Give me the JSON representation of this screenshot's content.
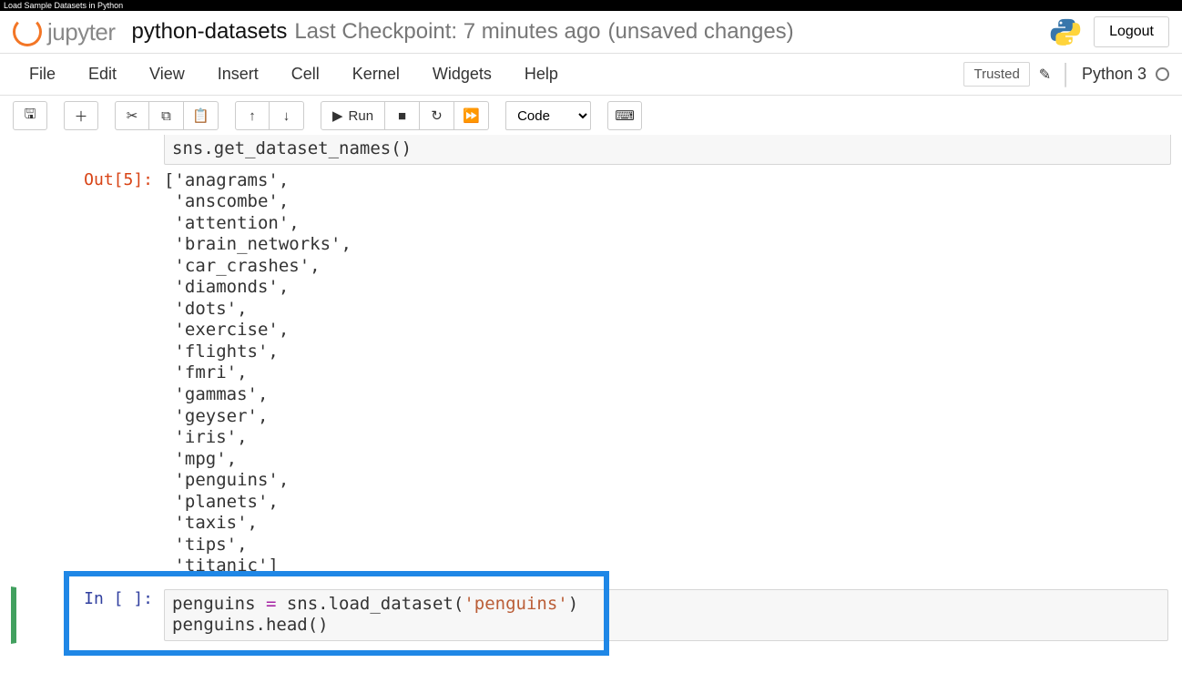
{
  "caption": "Load Sample Datasets in Python",
  "header": {
    "logo_text": "jupyter",
    "notebook_name": "python-datasets",
    "checkpoint": "Last Checkpoint: 7 minutes ago",
    "unsaved": "(unsaved changes)",
    "logout": "Logout"
  },
  "menus": {
    "file": "File",
    "edit": "Edit",
    "view": "View",
    "insert": "Insert",
    "cell": "Cell",
    "kernel": "Kernel",
    "widgets": "Widgets",
    "help": "Help"
  },
  "menubar_right": {
    "trusted": "Trusted",
    "kernel_name": "Python 3"
  },
  "toolbar": {
    "run_label": "Run",
    "celltype": "Code"
  },
  "cells": {
    "partial_code": "sns.get_dataset_names()",
    "out5_prompt": "Out[5]:",
    "out5_text": "['anagrams',\n 'anscombe',\n 'attention',\n 'brain_networks',\n 'car_crashes',\n 'diamonds',\n 'dots',\n 'exercise',\n 'flights',\n 'fmri',\n 'gammas',\n 'geyser',\n 'iris',\n 'mpg',\n 'penguins',\n 'planets',\n 'taxis',\n 'tips',\n 'titanic']",
    "in_empty_prompt": "In [ ]:",
    "code_line1_a": "penguins ",
    "code_line1_op": "=",
    "code_line1_b": " sns.load_dataset(",
    "code_line1_str": "'penguins'",
    "code_line1_c": ")",
    "code_line2_a": "penguins.head(",
    "code_line2_b": ")"
  }
}
